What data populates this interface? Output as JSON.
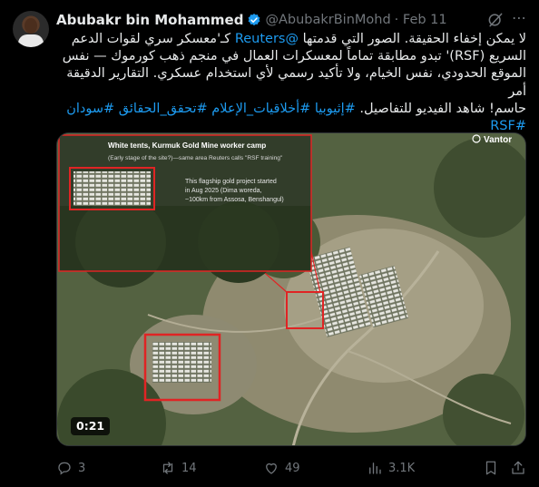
{
  "author": {
    "name": "Abubakr bin Mohammed",
    "handle": "@AbubakrBinMohd",
    "date": "· Feb 11",
    "verified": true
  },
  "tweet": {
    "line1": "لا يمكن إخفاء الحقيقة. الصور التي قدمتها",
    "mention": "@Reuters",
    "line1b": "كـ'معسكر سري لقوات الدعم",
    "line2": "السريع (RSF)' تبدو مطابقة تماماً لمعسكرات العمال في منجم ذهب كورموك — نفس",
    "line3": "الموقع الحدودي، نفس الخيام، ولا تأكيد رسمي لأي استخدام عسكري. التقارير الدقيقة أمر",
    "line4": "حاسم! شاهد الفيديو للتفاصيل.",
    "hashtags": "#إثيوبيا #أخلاقيات_الإعلام #تحقق_الحقائق #سودان",
    "hashtag_last": "#RSF"
  },
  "media": {
    "inset_title": "White tents, Kurmuk Gold Mine worker camp",
    "inset_sub": "(Early stage of the site?)—same area Reuters calls \"RSF training\"",
    "inset_note1": "This flagship gold project started",
    "inset_note2": "in Aug 2025 (Dima woreda,",
    "inset_note3": "~100km from Assosa, Benshangul)",
    "watermark": "Vantor",
    "duration": "0:21"
  },
  "actions": {
    "replies": "3",
    "reposts": "14",
    "likes": "49",
    "views": "3.1K"
  },
  "colors": {
    "background": "#000000",
    "text": "#e7e9ea",
    "muted": "#71767b",
    "link": "#1d9bf0",
    "verified": "#1d9bf0"
  }
}
